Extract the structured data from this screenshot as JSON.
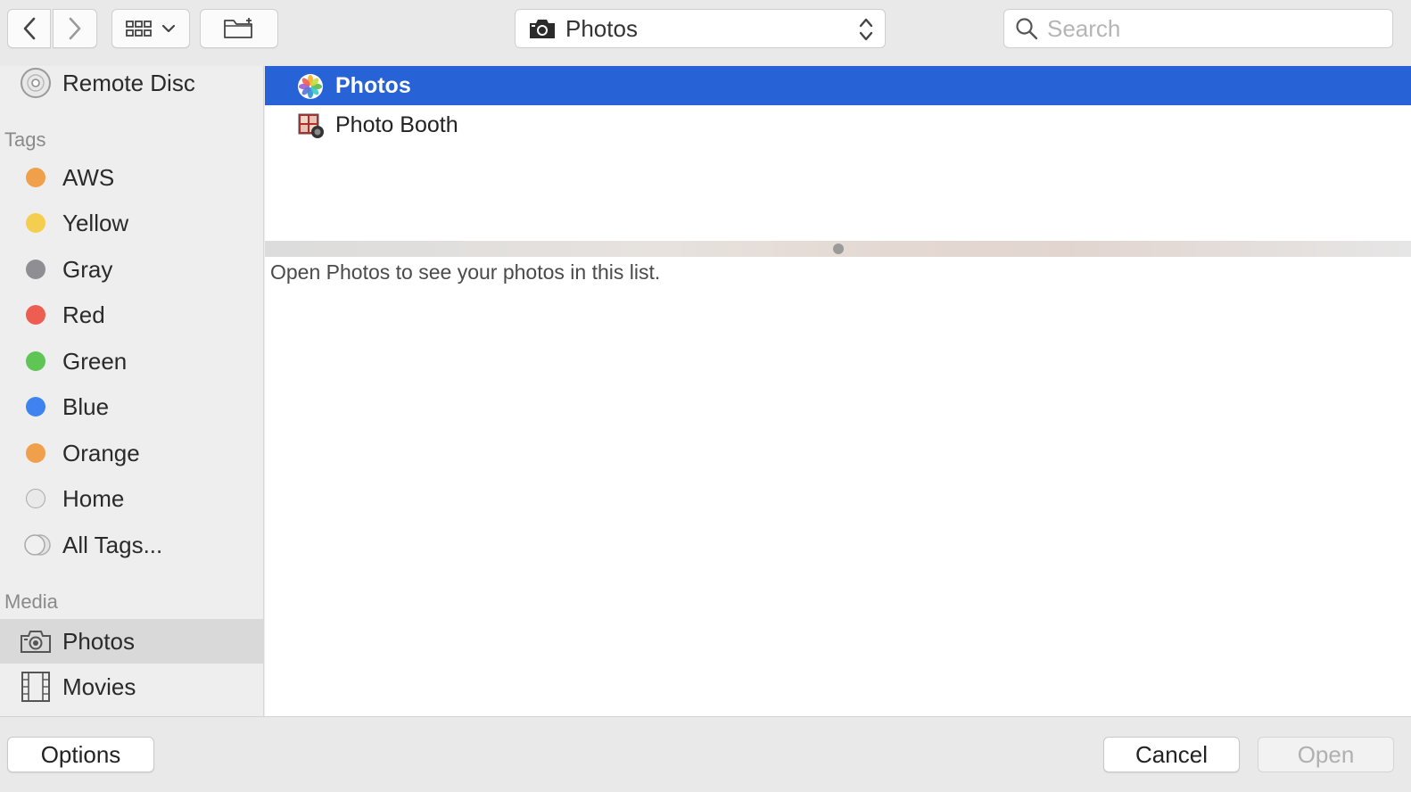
{
  "toolbar": {
    "location": {
      "label": "Photos",
      "icon": "camera-icon"
    },
    "search": {
      "placeholder": "Search",
      "value": ""
    }
  },
  "sidebar": {
    "top_item": {
      "label": "Remote Disc",
      "icon": "disc-icon"
    },
    "tags_header": "Tags",
    "tags": [
      {
        "label": "AWS",
        "color": "#f0a04b"
      },
      {
        "label": "Yellow",
        "color": "#f5cd4f"
      },
      {
        "label": "Gray",
        "color": "#8e8e93"
      },
      {
        "label": "Red",
        "color": "#ee5d52"
      },
      {
        "label": "Green",
        "color": "#5fc554"
      },
      {
        "label": "Blue",
        "color": "#3f82f0"
      },
      {
        "label": "Orange",
        "color": "#f0a04b"
      },
      {
        "label": "Home",
        "color": "#e9e9e9"
      },
      {
        "label": "All Tags...",
        "color": "#dcdcdc"
      }
    ],
    "media_header": "Media",
    "media": [
      {
        "label": "Photos",
        "icon": "camera-icon",
        "selected": true
      },
      {
        "label": "Movies",
        "icon": "film-icon",
        "selected": false
      }
    ]
  },
  "filelist": {
    "items": [
      {
        "label": "Photos",
        "icon": "photos-app-icon",
        "selected": true
      },
      {
        "label": "Photo Booth",
        "icon": "photo-booth-icon",
        "selected": false
      }
    ]
  },
  "preview": {
    "message": "Open Photos to see your photos in this list."
  },
  "footer": {
    "options_label": "Options",
    "cancel_label": "Cancel",
    "open_label": "Open"
  },
  "colors": {
    "selection": "#2862d7"
  }
}
